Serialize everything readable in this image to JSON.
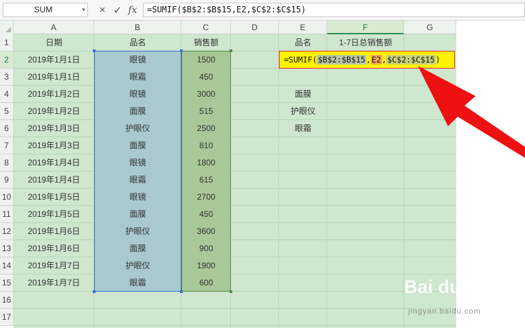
{
  "name_box": {
    "value": "SUM"
  },
  "toolbar": {
    "cancel_icon": "×",
    "confirm_icon": "✓",
    "fx_icon": "fx"
  },
  "formula_bar": {
    "value": "=SUMIF($B$2:$B$15,E2,$C$2:$C$15)"
  },
  "columns": [
    "A",
    "B",
    "C",
    "D",
    "E",
    "F",
    "G"
  ],
  "rows": [
    "1",
    "2",
    "3",
    "4",
    "5",
    "6",
    "7",
    "8",
    "9",
    "10",
    "11",
    "12",
    "13",
    "14",
    "15",
    "16",
    "17"
  ],
  "active_column": "F",
  "active_row": "2",
  "header_row": {
    "date": "日期",
    "product": "品名",
    "sales": "销售额",
    "e_header": "品名",
    "f_header": "1-7日总销售额"
  },
  "data_rows": [
    {
      "date": "2019年1月1日",
      "product": "眼镜",
      "sales": "1500"
    },
    {
      "date": "2019年1月1日",
      "product": "眼霜",
      "sales": "450"
    },
    {
      "date": "2019年1月2日",
      "product": "眼镜",
      "sales": "3000"
    },
    {
      "date": "2019年1月2日",
      "product": "面膜",
      "sales": "515"
    },
    {
      "date": "2019年1月3日",
      "product": "护眼仪",
      "sales": "2500"
    },
    {
      "date": "2019年1月3日",
      "product": "面膜",
      "sales": "810"
    },
    {
      "date": "2019年1月4日",
      "product": "眼镜",
      "sales": "1800"
    },
    {
      "date": "2019年1月4日",
      "product": "眼霜",
      "sales": "615"
    },
    {
      "date": "2019年1月5日",
      "product": "眼镜",
      "sales": "2700"
    },
    {
      "date": "2019年1月5日",
      "product": "面膜",
      "sales": "450"
    },
    {
      "date": "2019年1月6日",
      "product": "护眼仪",
      "sales": "3600"
    },
    {
      "date": "2019年1月6日",
      "product": "面膜",
      "sales": "900"
    },
    {
      "date": "2019年1月7日",
      "product": "护眼仪",
      "sales": "1900"
    },
    {
      "date": "2019年1月7日",
      "product": "眼霜",
      "sales": "600"
    }
  ],
  "lookup_list": [
    "面膜",
    "护眼仪",
    "眼霜"
  ],
  "active_cell_formula": {
    "prefix": "=SUMIF(",
    "range1": "$B$2:$B$15",
    "sep1": ",",
    "criteria": "E2",
    "sep2": ",",
    "range2": "$C$2:$C$15",
    "suffix": ")"
  },
  "watermark": {
    "logo": "Bai du 经验",
    "sub": "jingyan.baidu.com"
  },
  "colors": {
    "sheet_bg": "#cfe6cf",
    "active_fill": "#fff200",
    "arrow": "#ee1111",
    "range_b": "#3b6fd1",
    "range_c": "#4e8c3c"
  }
}
